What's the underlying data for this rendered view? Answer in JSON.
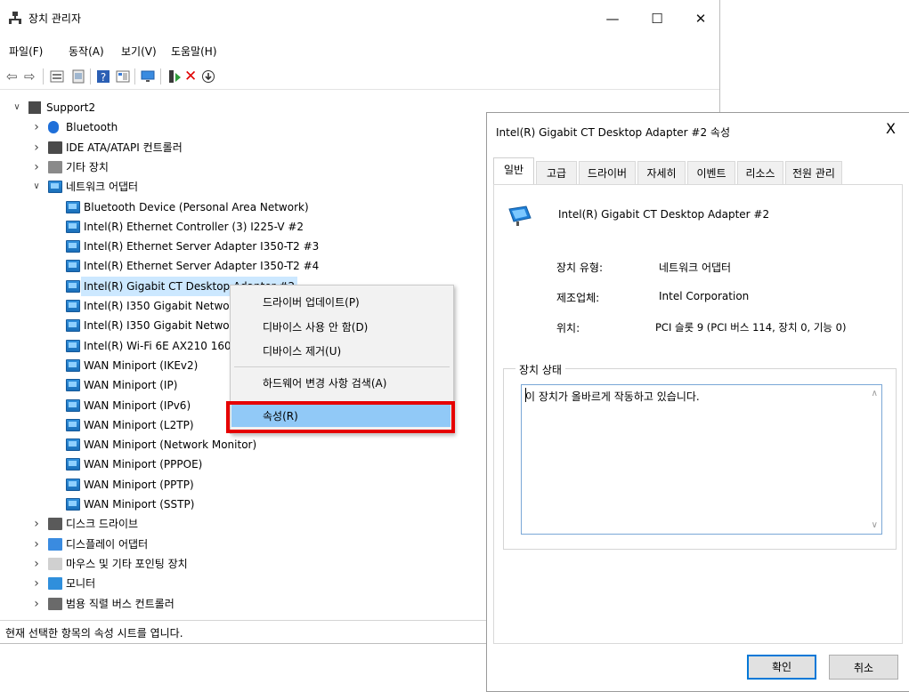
{
  "device_manager": {
    "title": "장치 관리자",
    "caption_buttons": {
      "minimize": "—",
      "maximize": "☐",
      "close": "✕"
    },
    "menu": [
      "파일(F)",
      "동작(A)",
      "보기(V)",
      "도움말(H)"
    ],
    "tree": {
      "root": "Support2",
      "items": [
        {
          "label": "Bluetooth",
          "expand": ">",
          "icon": "bluetooth-icon"
        },
        {
          "label": "IDE ATA/ATAPI 컨트롤러",
          "expand": ">",
          "icon": "ide-controller-icon"
        },
        {
          "label": "기타 장치",
          "expand": ">",
          "icon": "other-device-icon"
        },
        {
          "label": "네트워크 어댑터",
          "expand": "v",
          "icon": "network-adapter-icon"
        }
      ],
      "network_adapters": [
        "Bluetooth Device (Personal Area Network)",
        "Intel(R) Ethernet Controller (3) I225-V #2",
        "Intel(R) Ethernet Server Adapter I350-T2 #3",
        "Intel(R) Ethernet Server Adapter I350-T2 #4",
        "Intel(R) Gigabit CT Desktop Adapter #2",
        "Intel(R) I350 Gigabit Network",
        "Intel(R) I350 Gigabit Network",
        "Intel(R) Wi-Fi 6E AX210 160N",
        "WAN Miniport (IKEv2)",
        "WAN Miniport (IP)",
        "WAN Miniport (IPv6)",
        "WAN Miniport (L2TP)",
        "WAN Miniport (Network Monitor)",
        "WAN Miniport (PPPOE)",
        "WAN Miniport (PPTP)",
        "WAN Miniport (SSTP)"
      ],
      "after_items": [
        {
          "label": "디스크 드라이브",
          "icon": "disk-drive-icon"
        },
        {
          "label": "디스플레이 어댑터",
          "icon": "display-adapter-icon"
        },
        {
          "label": "마우스 및 기타 포인팅 장치",
          "icon": "mouse-icon"
        },
        {
          "label": "모니터",
          "icon": "monitor-icon"
        },
        {
          "label": "범용 직렬 버스 컨트롤러",
          "icon": "usb-controller-icon"
        }
      ]
    },
    "statusbar": "현재 선택한 항목의 속성 시트를 엽니다."
  },
  "context_menu": {
    "items": [
      "드라이버 업데이트(P)",
      "디바이스 사용 안 함(D)",
      "디바이스 제거(U)",
      "하드웨어 변경 사항 검색(A)",
      "속성(R)"
    ],
    "highlighted": "속성(R)",
    "highlight_color": "#91c9f7",
    "annotation_color": "#e60000"
  },
  "properties_dialog": {
    "title": "Intel(R) Gigabit CT Desktop Adapter #2 속성",
    "close": "X",
    "tabs": [
      "일반",
      "고급",
      "드라이버",
      "자세히",
      "이벤트",
      "리소스",
      "전원 관리"
    ],
    "active_tab": "일반",
    "device_name": "Intel(R) Gigabit CT Desktop Adapter #2",
    "fields": [
      {
        "key": "장치 유형:",
        "value": "네트워크 어댑터"
      },
      {
        "key": "제조업체:",
        "value": "Intel Corporation"
      },
      {
        "key": "위치:",
        "value": "PCI 슬롯 9 (PCI 버스 114, 장치 0, 기능 0)"
      }
    ],
    "status_group_label": "장치 상태",
    "status_text": "이 장치가 올바르게 작동하고 있습니다.",
    "ok_label": "확인",
    "cancel_label": "취소"
  }
}
